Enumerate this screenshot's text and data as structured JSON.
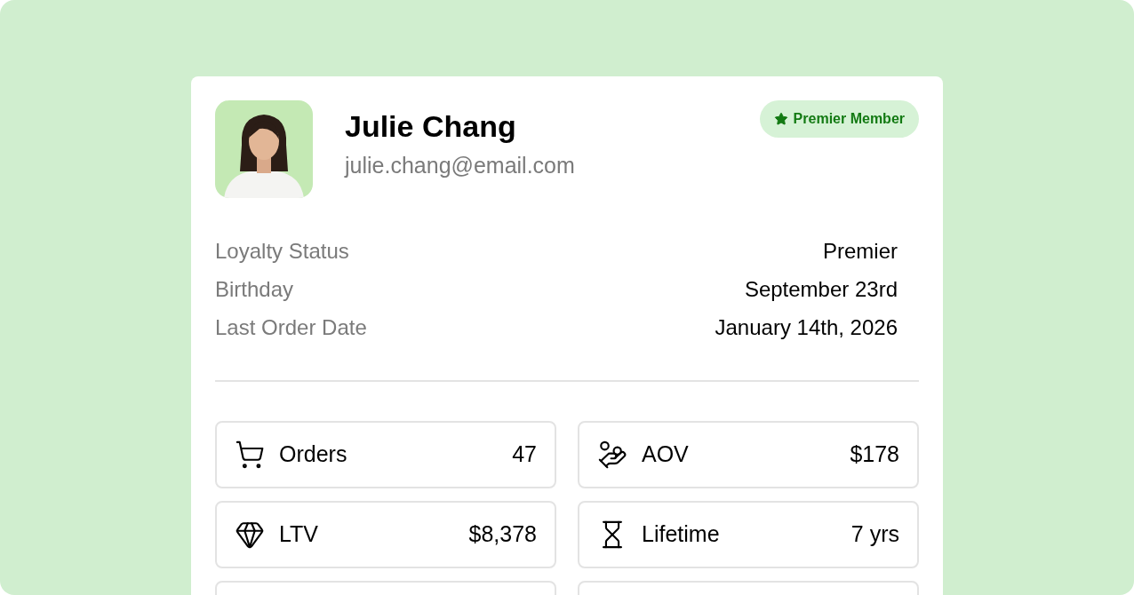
{
  "profile": {
    "name": "Julie Chang",
    "email": "julie.chang@email.com",
    "badge": "Premier Member"
  },
  "details": [
    {
      "label": "Loyalty Status",
      "value": "Premier"
    },
    {
      "label": "Birthday",
      "value": "September 23rd"
    },
    {
      "label": "Last Order Date",
      "value": "January 14th, 2026"
    }
  ],
  "stats": [
    {
      "kind": "cart",
      "label": "Orders",
      "value": "47"
    },
    {
      "kind": "coins",
      "label": "AOV",
      "value": "$178"
    },
    {
      "kind": "gem",
      "label": "LTV",
      "value": "$8,378"
    },
    {
      "kind": "hourglass",
      "label": "Lifetime",
      "value": "7 yrs"
    }
  ]
}
